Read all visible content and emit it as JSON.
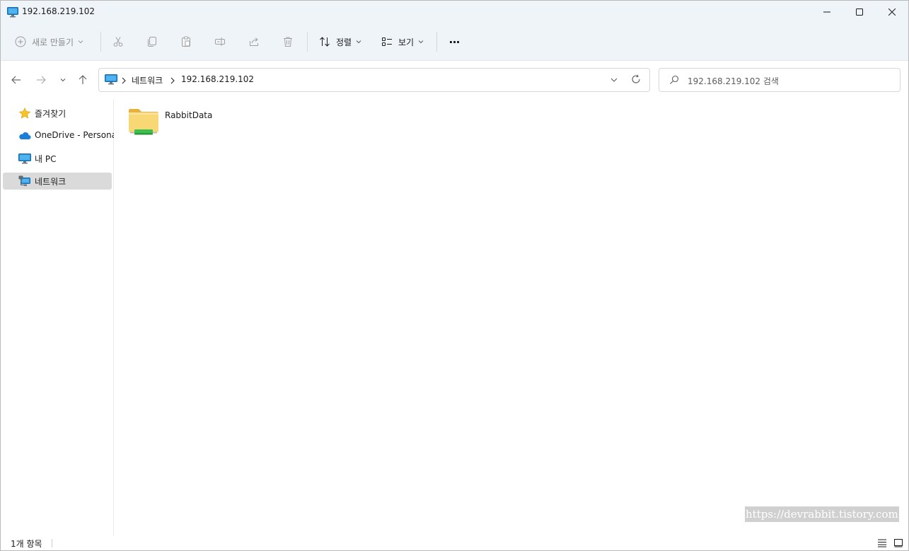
{
  "window": {
    "title": "192.168.219.102"
  },
  "toolbar": {
    "new_label": "새로 만들기",
    "sort_label": "정렬",
    "view_label": "보기",
    "more_label": "···"
  },
  "address": {
    "crumbs": [
      "네트워크",
      "192.168.219.102"
    ]
  },
  "search": {
    "placeholder": "192.168.219.102 검색"
  },
  "sidebar": {
    "items": [
      {
        "label": "즐겨찾기",
        "icon": "star-icon"
      },
      {
        "label": "OneDrive - Personal",
        "icon": "cloud-icon"
      },
      {
        "label": "내 PC",
        "icon": "monitor-icon"
      },
      {
        "label": "네트워크",
        "icon": "network-icon"
      }
    ],
    "selected": 3
  },
  "files": [
    {
      "name": "RabbitData",
      "icon": "shared-folder-icon"
    }
  ],
  "status": {
    "count": "1개 항목"
  },
  "watermark": "https://devrabbit.tistory.com",
  "colors": {
    "chrome_bg": "#eff4f9",
    "selected_bg": "#dadada",
    "accent": "#0067c0",
    "folder": "#f8d775"
  }
}
